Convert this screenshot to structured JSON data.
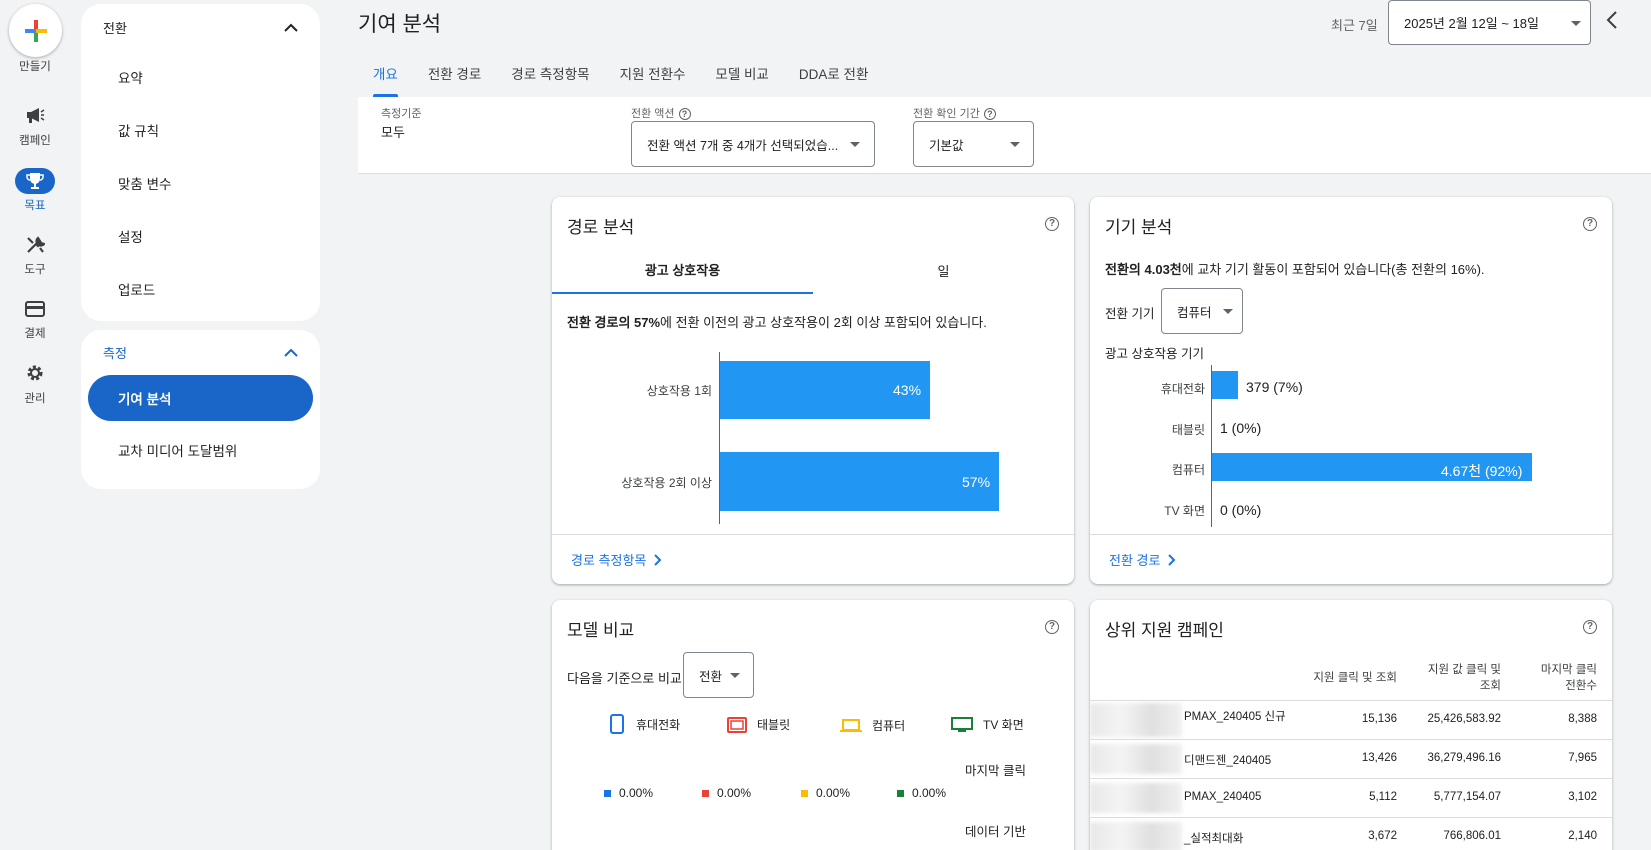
{
  "rail": {
    "create_label": "만들기",
    "items": [
      {
        "label": "캠페인",
        "icon": "megaphone-icon"
      },
      {
        "label": "목표",
        "icon": "trophy-icon"
      },
      {
        "label": "도구",
        "icon": "tools-icon"
      },
      {
        "label": "결제",
        "icon": "credit-card-icon"
      },
      {
        "label": "관리",
        "icon": "gear-icon"
      }
    ]
  },
  "sidenav": {
    "section1_title": "전환",
    "section1_items": [
      "요약",
      "값 규칙",
      "맞춤 변수",
      "설정",
      "업로드"
    ],
    "section2_title": "측정",
    "section2_items": [
      "기여 분석",
      "교차 미디어 도달범위"
    ]
  },
  "header": {
    "title": "기여 분석",
    "date_label": "최근 7일",
    "date_range": "2025년 2월 12일 ~ 18일"
  },
  "tabs": [
    "개요",
    "전환 경로",
    "경로 측정항목",
    "지원 전환수",
    "모델 비교",
    "DDA로 전환"
  ],
  "filters": {
    "basis_label": "측정기준",
    "basis_value": "모두",
    "action_label": "전환 액션",
    "action_value": "전환 액션 7개 중 4개가 선택되었습...",
    "window_label": "전환 확인 기간",
    "window_value": "기본값"
  },
  "path_card": {
    "title": "경로 분석",
    "tab_active": "광고 상호작용",
    "tab_other": "일",
    "summary_bold": "전환 경로의 57%",
    "summary_rest": "에 전환 이전의 광고 상호작용이 2회 이상 포함되어 있습니다.",
    "footer_link": "경로 측정항목"
  },
  "device_card": {
    "title": "기기 분석",
    "summary_bold": "전환의 4.03천",
    "summary_rest": "에 교차 기기 활동이 포함되어 있습니다(총 전환의 16%).",
    "device_label": "전환 기기",
    "device_value": "컴퓨터",
    "chart_caption": "광고 상호작용 기기",
    "footer_link": "전환 경로"
  },
  "model_card": {
    "title": "모델 비교",
    "compare_label": "다음을 기준으로 비교",
    "compare_value": "전환",
    "legend": [
      {
        "name": "휴대전화",
        "color": "#1a73e8",
        "icon": "phone-icon"
      },
      {
        "name": "태블릿",
        "color": "#ea4335",
        "icon": "tablet-icon"
      },
      {
        "name": "컴퓨터",
        "color": "#fbbc04",
        "icon": "laptop-icon"
      },
      {
        "name": "TV 화면",
        "color": "#188038",
        "icon": "tv-icon"
      }
    ],
    "row1_label": "마지막 클릭",
    "row1_values": [
      "0.00%",
      "0.00%",
      "0.00%",
      "0.00%"
    ],
    "row2_label": "데이터 기반"
  },
  "campaign_card": {
    "title": "상위 지원 캠페인",
    "col1_a": "지원 클릭 및 조회",
    "col2_a": "지원 값 클릭 및",
    "col2_b": "조회",
    "col3_a": "마지막 클릭",
    "col3_b": "전환수",
    "rows": [
      {
        "name": "PMAX_240405 신규",
        "c1": "15,136",
        "c2": "25,426,583.92",
        "c3": "8,388"
      },
      {
        "name": "디맨드젠_240405",
        "c1": "13,426",
        "c2": "36,279,496.16",
        "c3": "7,965"
      },
      {
        "name": "PMAX_240405",
        "c1": "5,112",
        "c2": "5,777,154.07",
        "c3": "3,102"
      },
      {
        "name": "_실적최대화",
        "c1": "3,672",
        "c2": "766,806.01",
        "c3": "2,140"
      }
    ]
  },
  "chart_data": [
    {
      "type": "bar",
      "orientation": "horizontal",
      "categories": [
        "상호작용 1회",
        "상호작용 2회 이상"
      ],
      "values": [
        43,
        57
      ],
      "value_labels": [
        "43%",
        "57%"
      ],
      "xlim": [
        0,
        60
      ]
    },
    {
      "type": "bar",
      "orientation": "horizontal",
      "categories": [
        "휴대전화",
        "태블릿",
        "컴퓨터",
        "TV 화면"
      ],
      "values": [
        379,
        1,
        4670,
        0
      ],
      "value_labels": [
        "379 (7%)",
        "1 (0%)",
        "4.67천 (92%)",
        "0 (0%)"
      ]
    }
  ]
}
